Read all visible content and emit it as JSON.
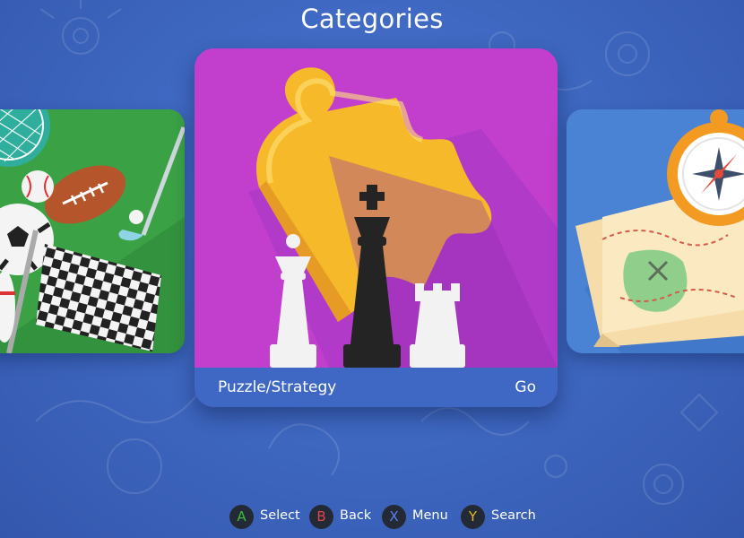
{
  "screen": {
    "title": "Categories"
  },
  "carousel": {
    "left_card": {
      "icon": "sports-icon"
    },
    "selected_card": {
      "label": "Puzzle/Strategy",
      "action": "Go",
      "icon": "puzzle-chess-icon",
      "color": "#c23fce"
    },
    "right_card": {
      "icon": "treasure-map-icon"
    }
  },
  "hints": [
    {
      "key": "A",
      "label": "Select",
      "color": "#3dbb3d"
    },
    {
      "key": "B",
      "label": "Back",
      "color": "#e0454a"
    },
    {
      "key": "X",
      "label": "Menu",
      "color": "#5c7ff0"
    },
    {
      "key": "Y",
      "label": "Search",
      "color": "#e6b821"
    }
  ],
  "colors": {
    "background": "#3f69c2",
    "footer": "#3f67c4"
  }
}
